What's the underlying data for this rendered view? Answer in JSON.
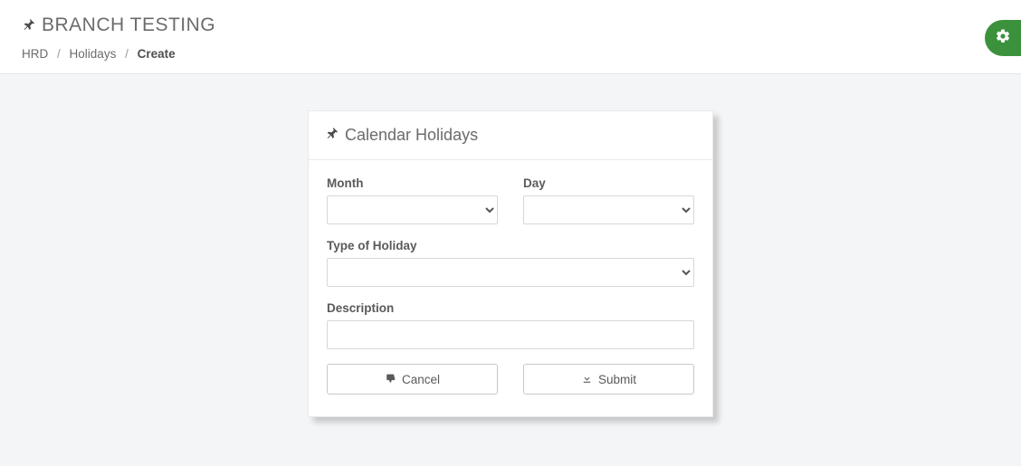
{
  "header": {
    "title": "BRANCH TESTING",
    "breadcrumb": [
      "HRD",
      "Holidays",
      "Create"
    ]
  },
  "card": {
    "title": "Calendar Holidays",
    "fields": {
      "month_label": "Month",
      "day_label": "Day",
      "type_label": "Type of Holiday",
      "description_label": "Description",
      "month_value": "",
      "day_value": "",
      "type_value": "",
      "description_value": ""
    },
    "buttons": {
      "cancel": "Cancel",
      "submit": "Submit"
    }
  }
}
